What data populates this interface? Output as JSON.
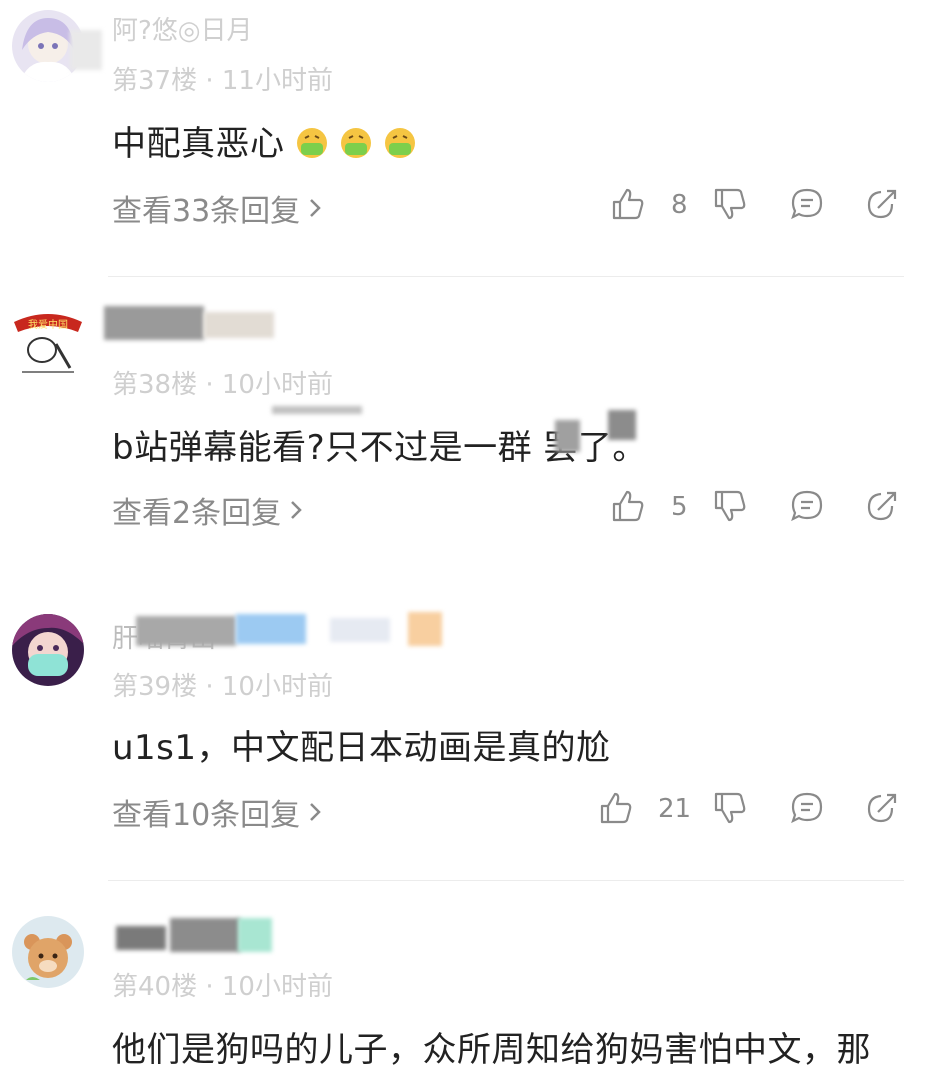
{
  "comments": [
    {
      "name_partial": "阿?悠◎日月",
      "floor": "第37楼 · 11小时前",
      "content": "中配真恶心",
      "emojis": [
        "vomit-emoji",
        "vomit-emoji",
        "vomit-emoji"
      ],
      "replies_label": "查看33条回复",
      "likes": "8"
    },
    {
      "name_partial": "",
      "floor": "第38楼 · 10小时前",
      "content": "b站弹幕能看?只不过是一群    罢了。",
      "replies_label": "查看2条回复",
      "likes": "5"
    },
    {
      "name_partial": "肝喵霄出",
      "floor": "第39楼 · 10小时前",
      "content": "u1s1，中文配日本动画是真的尬",
      "replies_label": "查看10条回复",
      "likes": "21"
    },
    {
      "name_partial": "",
      "floor": "第40楼 · 10小时前",
      "content": "他们是狗吗的儿子，众所周知给狗妈害怕中文，那"
    }
  ],
  "colors": {
    "text": "#222222",
    "muted": "#8a8a8a",
    "divider": "#ececec"
  }
}
